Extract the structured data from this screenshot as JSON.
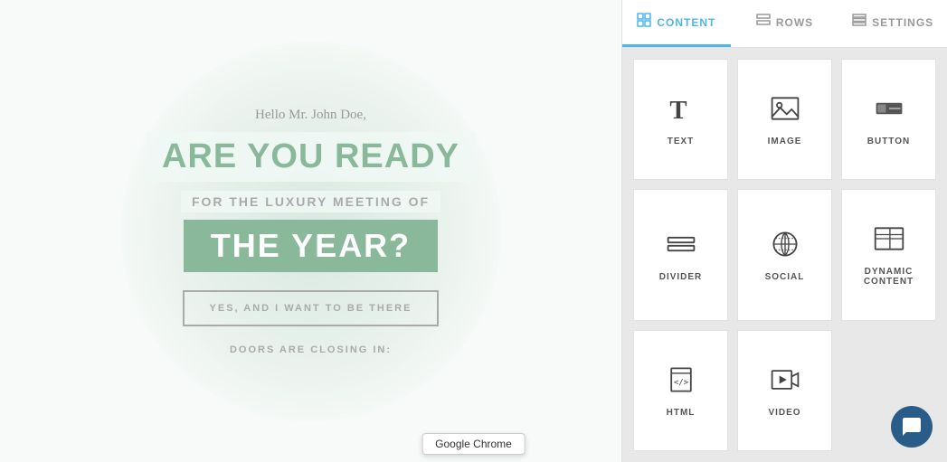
{
  "tabs": [
    {
      "id": "content",
      "label": "CONTENT",
      "active": true,
      "icon": "grid"
    },
    {
      "id": "rows",
      "label": "ROWS",
      "active": false,
      "icon": "rows"
    },
    {
      "id": "settings",
      "label": "SETTINGS",
      "active": false,
      "icon": "settings"
    }
  ],
  "email": {
    "greeting": "Hello Mr. John Doe,",
    "headline": "ARE YOU READY",
    "subline": "FOR THE LUXURY MEETING OF",
    "year_line": "THE YEAR?",
    "cta_button": "YES, AND I WANT TO BE THERE",
    "doors_text": "DOORS ARE CLOSING IN:"
  },
  "content_items": [
    {
      "id": "text",
      "label": "TEXT"
    },
    {
      "id": "image",
      "label": "IMAGE"
    },
    {
      "id": "button",
      "label": "BUTTON"
    },
    {
      "id": "divider",
      "label": "DIVIDER"
    },
    {
      "id": "social",
      "label": "SOCIAL"
    },
    {
      "id": "dynamic_content",
      "label": "DYNAMIC CONTENT"
    },
    {
      "id": "html",
      "label": "HTML"
    },
    {
      "id": "video",
      "label": "VIDEO"
    }
  ],
  "tooltip": "Google Chrome",
  "colors": {
    "accent": "#4db6e8",
    "green": "#8ab89a",
    "dark_panel": "#2a5c8a"
  }
}
